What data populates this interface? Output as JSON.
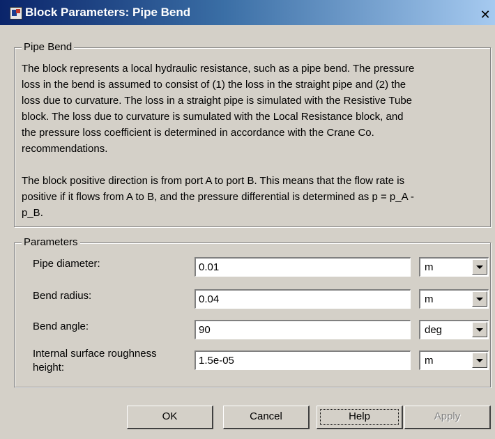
{
  "window": {
    "title": "Block Parameters: Pipe Bend",
    "close_glyph": "✕"
  },
  "description_group": {
    "title": "Pipe Bend",
    "text": "The block represents a local hydraulic resistance, such as a pipe bend. The pressure\nloss in the bend is assumed to consist of (1) the loss in the straight pipe and (2) the\nloss due to curvature. The loss in a straight pipe is simulated with the Resistive Tube\nblock. The loss due to curvature is sumulated with the Local Resistance block, and\nthe pressure loss coefficient is determined in accordance with the Crane Co.\nrecommendations.\n\nThe block positive direction is from port A to port B. This means that the flow rate is\npositive if it flows from A to B, and the pressure differential is determined as p = p_A -\np_B."
  },
  "parameters_group": {
    "title": "Parameters",
    "rows": [
      {
        "label": "Pipe diameter:",
        "value": "0.01",
        "unit": "m"
      },
      {
        "label": "Bend radius:",
        "value": "0.04",
        "unit": "m"
      },
      {
        "label": "Bend angle:",
        "value": "90",
        "unit": "deg"
      },
      {
        "label": "Internal surface roughness\nheight:",
        "value": "1.5e-05",
        "unit": "m"
      }
    ]
  },
  "buttons": {
    "ok": "OK",
    "cancel": "Cancel",
    "help": "Help",
    "apply": "Apply"
  },
  "icons": {
    "title": "simulink-block-icon",
    "close": "close-icon",
    "dropdown": "chevron-down-icon"
  }
}
